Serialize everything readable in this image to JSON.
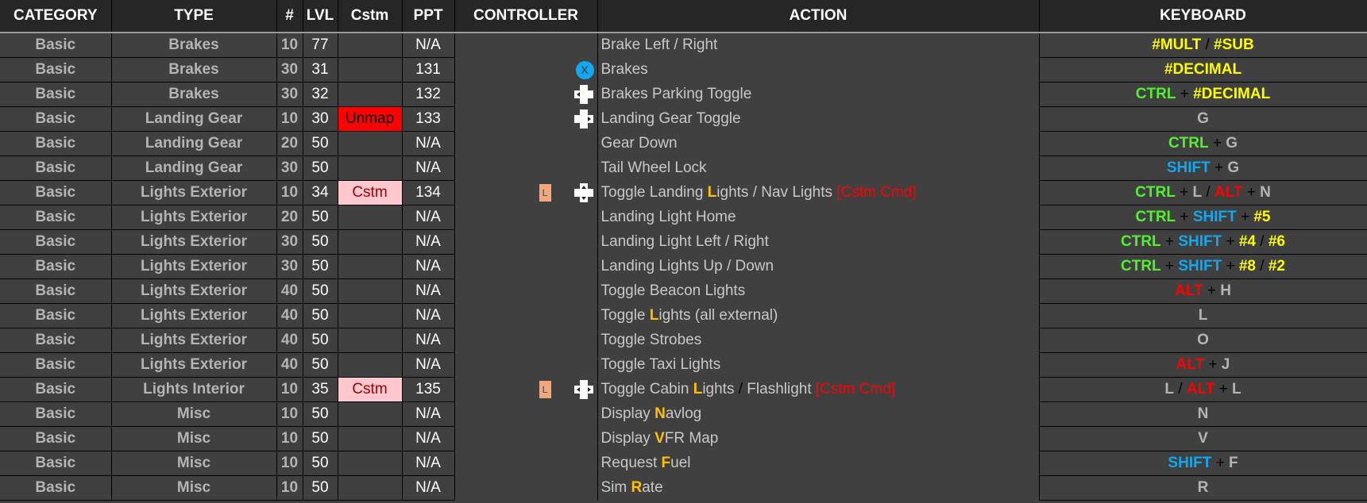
{
  "headers": {
    "category": "CATEGORY",
    "type": "TYPE",
    "num": "#",
    "lvl": "LVL",
    "cstm": "Cstm",
    "ppt": "PPT",
    "controller": "CONTROLLER",
    "action": "ACTION",
    "keyboard": "KEYBOARD"
  },
  "colors": {
    "header_bg": "#262626",
    "body_bg": "#404040",
    "unmap_bg": "#ff0000",
    "cstm_bg": "#ffc7ce",
    "cstm_text": "#9c0006",
    "highlight": "#ffc000",
    "ctrl_key": "#55ee33",
    "shift_key": "#11a8f0",
    "alt_key": "#ff0000",
    "numpad_key": "#ffff00"
  },
  "rows": [
    {
      "category": "Basic",
      "type": "Brakes",
      "num": "10",
      "lvl": "77",
      "cstm": "",
      "ppt": "N/A",
      "controller": [],
      "action": [
        {
          "t": "Brake Left / Right"
        }
      ],
      "keyboard": [
        {
          "t": "#MULT",
          "k": "num"
        },
        {
          "t": " / ",
          "k": "sep"
        },
        {
          "t": "#SUB",
          "k": "num"
        }
      ]
    },
    {
      "category": "Basic",
      "type": "Brakes",
      "num": "30",
      "lvl": "31",
      "cstm": "",
      "ppt": "131",
      "controller": [
        "x-button-icon"
      ],
      "action": [
        {
          "t": "Brakes"
        }
      ],
      "keyboard": [
        {
          "t": "#DECIMAL",
          "k": "num"
        }
      ]
    },
    {
      "category": "Basic",
      "type": "Brakes",
      "num": "30",
      "lvl": "32",
      "cstm": "",
      "ppt": "132",
      "controller": [
        "dpad-left-icon"
      ],
      "action": [
        {
          "t": "Brakes Parking Toggle"
        }
      ],
      "keyboard": [
        {
          "t": "CTRL",
          "k": "ctrl"
        },
        {
          "t": " + ",
          "k": "sep"
        },
        {
          "t": "#DECIMAL",
          "k": "num"
        }
      ]
    },
    {
      "category": "Basic",
      "type": "Landing Gear",
      "num": "10",
      "lvl": "30",
      "cstm": "Unmap",
      "ppt": "133",
      "controller": [
        "dpad-right-icon"
      ],
      "action": [
        {
          "t": "Landing Gear Toggle"
        }
      ],
      "keyboard": [
        {
          "t": "G",
          "k": "key"
        }
      ]
    },
    {
      "category": "Basic",
      "type": "Landing Gear",
      "num": "20",
      "lvl": "50",
      "cstm": "",
      "ppt": "N/A",
      "controller": [],
      "action": [
        {
          "t": "Gear Down"
        }
      ],
      "keyboard": [
        {
          "t": "CTRL",
          "k": "ctrl"
        },
        {
          "t": " + ",
          "k": "sep"
        },
        {
          "t": "G",
          "k": "key"
        }
      ]
    },
    {
      "category": "Basic",
      "type": "Landing Gear",
      "num": "30",
      "lvl": "50",
      "cstm": "",
      "ppt": "N/A",
      "controller": [],
      "action": [
        {
          "t": "Tail Wheel Lock"
        }
      ],
      "keyboard": [
        {
          "t": "SHIFT",
          "k": "shift"
        },
        {
          "t": " + ",
          "k": "sep"
        },
        {
          "t": "G",
          "k": "key"
        }
      ]
    },
    {
      "category": "Basic",
      "type": "Lights Exterior",
      "num": "10",
      "lvl": "34",
      "cstm": "Cstm",
      "ppt": "134",
      "controller": [
        "l-button-icon",
        "dpad-updown-icon"
      ],
      "action": [
        {
          "t": "Toggle Landing "
        },
        {
          "t": "L",
          "s": "hl"
        },
        {
          "t": "ights / Nav Lights "
        },
        {
          "t": "[Cstm Cmd]",
          "s": "cmd"
        }
      ],
      "keyboard": [
        {
          "t": "CTRL",
          "k": "ctrl"
        },
        {
          "t": " + ",
          "k": "sep"
        },
        {
          "t": "L",
          "k": "key"
        },
        {
          "t": " / ",
          "k": "sep"
        },
        {
          "t": "ALT",
          "k": "alt"
        },
        {
          "t": " + ",
          "k": "sep"
        },
        {
          "t": "N",
          "k": "key"
        }
      ]
    },
    {
      "category": "Basic",
      "type": "Lights Exterior",
      "num": "20",
      "lvl": "50",
      "cstm": "",
      "ppt": "N/A",
      "controller": [],
      "action": [
        {
          "t": "Landing Light Home"
        }
      ],
      "keyboard": [
        {
          "t": "CTRL",
          "k": "ctrl"
        },
        {
          "t": " + ",
          "k": "sep"
        },
        {
          "t": "SHIFT",
          "k": "shift"
        },
        {
          "t": " + ",
          "k": "sep"
        },
        {
          "t": "#5",
          "k": "num"
        }
      ]
    },
    {
      "category": "Basic",
      "type": "Lights Exterior",
      "num": "30",
      "lvl": "50",
      "cstm": "",
      "ppt": "N/A",
      "controller": [],
      "action": [
        {
          "t": "Landing Light Left / Right"
        }
      ],
      "keyboard": [
        {
          "t": "CTRL",
          "k": "ctrl"
        },
        {
          "t": " + ",
          "k": "sep"
        },
        {
          "t": "SHIFT",
          "k": "shift"
        },
        {
          "t": " + ",
          "k": "sep"
        },
        {
          "t": "#4",
          "k": "num"
        },
        {
          "t": " / ",
          "k": "sep"
        },
        {
          "t": "#6",
          "k": "num"
        }
      ]
    },
    {
      "category": "Basic",
      "type": "Lights Exterior",
      "num": "30",
      "lvl": "50",
      "cstm": "",
      "ppt": "N/A",
      "controller": [],
      "action": [
        {
          "t": "Landing Lights Up / Down"
        }
      ],
      "keyboard": [
        {
          "t": "CTRL",
          "k": "ctrl"
        },
        {
          "t": " + ",
          "k": "sep"
        },
        {
          "t": "SHIFT",
          "k": "shift"
        },
        {
          "t": " + ",
          "k": "sep"
        },
        {
          "t": "#8",
          "k": "num"
        },
        {
          "t": " / ",
          "k": "sep"
        },
        {
          "t": "#2",
          "k": "num"
        }
      ]
    },
    {
      "category": "Basic",
      "type": "Lights Exterior",
      "num": "40",
      "lvl": "50",
      "cstm": "",
      "ppt": "N/A",
      "controller": [],
      "action": [
        {
          "t": "Toggle Beacon Lights"
        }
      ],
      "keyboard": [
        {
          "t": "ALT",
          "k": "alt"
        },
        {
          "t": " + ",
          "k": "sep"
        },
        {
          "t": "H",
          "k": "key"
        }
      ]
    },
    {
      "category": "Basic",
      "type": "Lights Exterior",
      "num": "40",
      "lvl": "50",
      "cstm": "",
      "ppt": "N/A",
      "controller": [],
      "action": [
        {
          "t": "Toggle "
        },
        {
          "t": "L",
          "s": "hl"
        },
        {
          "t": "ights (all external)"
        }
      ],
      "keyboard": [
        {
          "t": "L",
          "k": "key"
        }
      ]
    },
    {
      "category": "Basic",
      "type": "Lights Exterior",
      "num": "40",
      "lvl": "50",
      "cstm": "",
      "ppt": "N/A",
      "controller": [],
      "action": [
        {
          "t": "Toggle Strobes"
        }
      ],
      "keyboard": [
        {
          "t": "O",
          "k": "key"
        }
      ]
    },
    {
      "category": "Basic",
      "type": "Lights Exterior",
      "num": "40",
      "lvl": "50",
      "cstm": "",
      "ppt": "N/A",
      "controller": [],
      "action": [
        {
          "t": "Toggle Taxi Lights"
        }
      ],
      "keyboard": [
        {
          "t": "ALT",
          "k": "alt"
        },
        {
          "t": " + ",
          "k": "sep"
        },
        {
          "t": "J",
          "k": "key"
        }
      ]
    },
    {
      "category": "Basic",
      "type": "Lights Interior",
      "num": "10",
      "lvl": "35",
      "cstm": "Cstm",
      "ppt": "135",
      "controller": [
        "l-button-icon",
        "dpad-leftright-icon"
      ],
      "action": [
        {
          "t": "Toggle Cabin "
        },
        {
          "t": "L",
          "s": "hl"
        },
        {
          "t": "ights "
        },
        {
          "t": "/",
          "s": "sep"
        },
        {
          "t": " Flashlight "
        },
        {
          "t": "[Cstm Cmd]",
          "s": "cmd"
        }
      ],
      "keyboard": [
        {
          "t": "L",
          "k": "key"
        },
        {
          "t": " / ",
          "k": "sep"
        },
        {
          "t": "ALT",
          "k": "alt"
        },
        {
          "t": " + ",
          "k": "sep"
        },
        {
          "t": "L",
          "k": "key"
        }
      ]
    },
    {
      "category": "Basic",
      "type": "Misc",
      "num": "10",
      "lvl": "50",
      "cstm": "",
      "ppt": "N/A",
      "controller": [],
      "action": [
        {
          "t": "Display "
        },
        {
          "t": "N",
          "s": "hl"
        },
        {
          "t": "avlog"
        }
      ],
      "keyboard": [
        {
          "t": "N",
          "k": "key"
        }
      ]
    },
    {
      "category": "Basic",
      "type": "Misc",
      "num": "10",
      "lvl": "50",
      "cstm": "",
      "ppt": "N/A",
      "controller": [],
      "action": [
        {
          "t": "Display "
        },
        {
          "t": "V",
          "s": "hl"
        },
        {
          "t": "FR Map"
        }
      ],
      "keyboard": [
        {
          "t": "V",
          "k": "key"
        }
      ]
    },
    {
      "category": "Basic",
      "type": "Misc",
      "num": "10",
      "lvl": "50",
      "cstm": "",
      "ppt": "N/A",
      "controller": [],
      "action": [
        {
          "t": "Request "
        },
        {
          "t": "F",
          "s": "hl"
        },
        {
          "t": "uel"
        }
      ],
      "keyboard": [
        {
          "t": "SHIFT",
          "k": "shift"
        },
        {
          "t": " + ",
          "k": "sep"
        },
        {
          "t": "F",
          "k": "key"
        }
      ]
    },
    {
      "category": "Basic",
      "type": "Misc",
      "num": "10",
      "lvl": "50",
      "cstm": "",
      "ppt": "N/A",
      "controller": [],
      "action": [
        {
          "t": "Sim "
        },
        {
          "t": "R",
          "s": "hl"
        },
        {
          "t": "ate"
        }
      ],
      "keyboard": [
        {
          "t": "R",
          "k": "key"
        }
      ]
    }
  ],
  "icon_glyphs": {
    "x-button-icon": "X",
    "l-button-icon": "L"
  }
}
